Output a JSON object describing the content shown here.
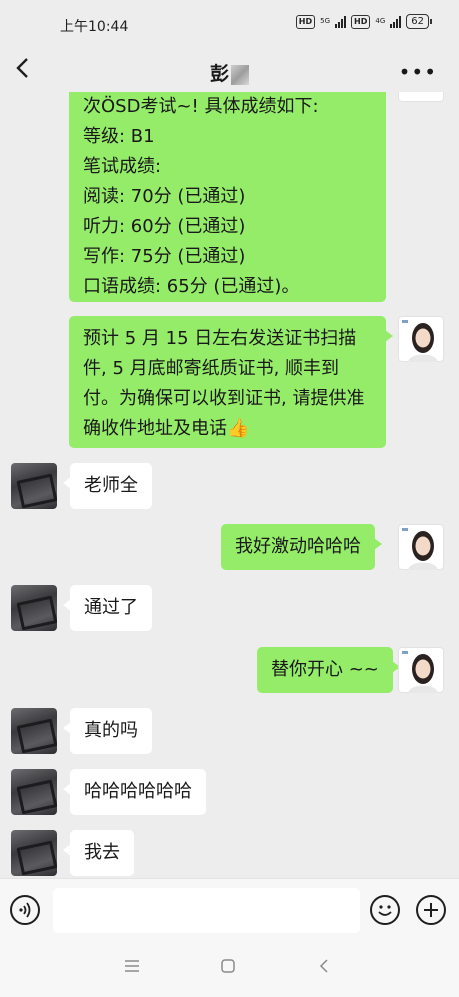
{
  "status_bar": {
    "time": "上午10:44",
    "hd1": "HD",
    "net1": "5G",
    "hd2": "HD",
    "net2": "4G",
    "battery": "62"
  },
  "header": {
    "title": "彭",
    "more_icon": "more-dots-icon"
  },
  "messages": [
    {
      "from": "me",
      "text": "次ÖSD考试~! 具体成绩如下:\n等级: B1\n笔试成绩:\n阅读: 70分 (已通过)\n听力: 60分 (已通过)\n写作: 75分 (已通过)\n口语成绩: 65分 (已通过)。"
    },
    {
      "from": "me",
      "text": "预计 5 月 15 日左右发送证书扫描件, 5 月底邮寄纸质证书, 顺丰到付。为确保可以收到证书, 请提供准确收件地址及电话",
      "emoji": "👍"
    },
    {
      "from": "other",
      "text": "老师全"
    },
    {
      "from": "me",
      "text": "我好激动哈哈哈"
    },
    {
      "from": "other",
      "text": "通过了"
    },
    {
      "from": "me",
      "text": "替你开心 ~~"
    },
    {
      "from": "other",
      "text": "真的吗"
    },
    {
      "from": "other",
      "text": "哈哈哈哈哈哈"
    },
    {
      "from": "other",
      "text": "我去"
    }
  ],
  "input_bar": {
    "voice_icon": "voice-icon",
    "text_value": "",
    "emoji_icon": "emoji-icon",
    "add_icon": "add-icon"
  },
  "nav_bar": {
    "menu_icon": "menu-icon",
    "home_icon": "home-icon",
    "back_icon": "back-icon"
  }
}
